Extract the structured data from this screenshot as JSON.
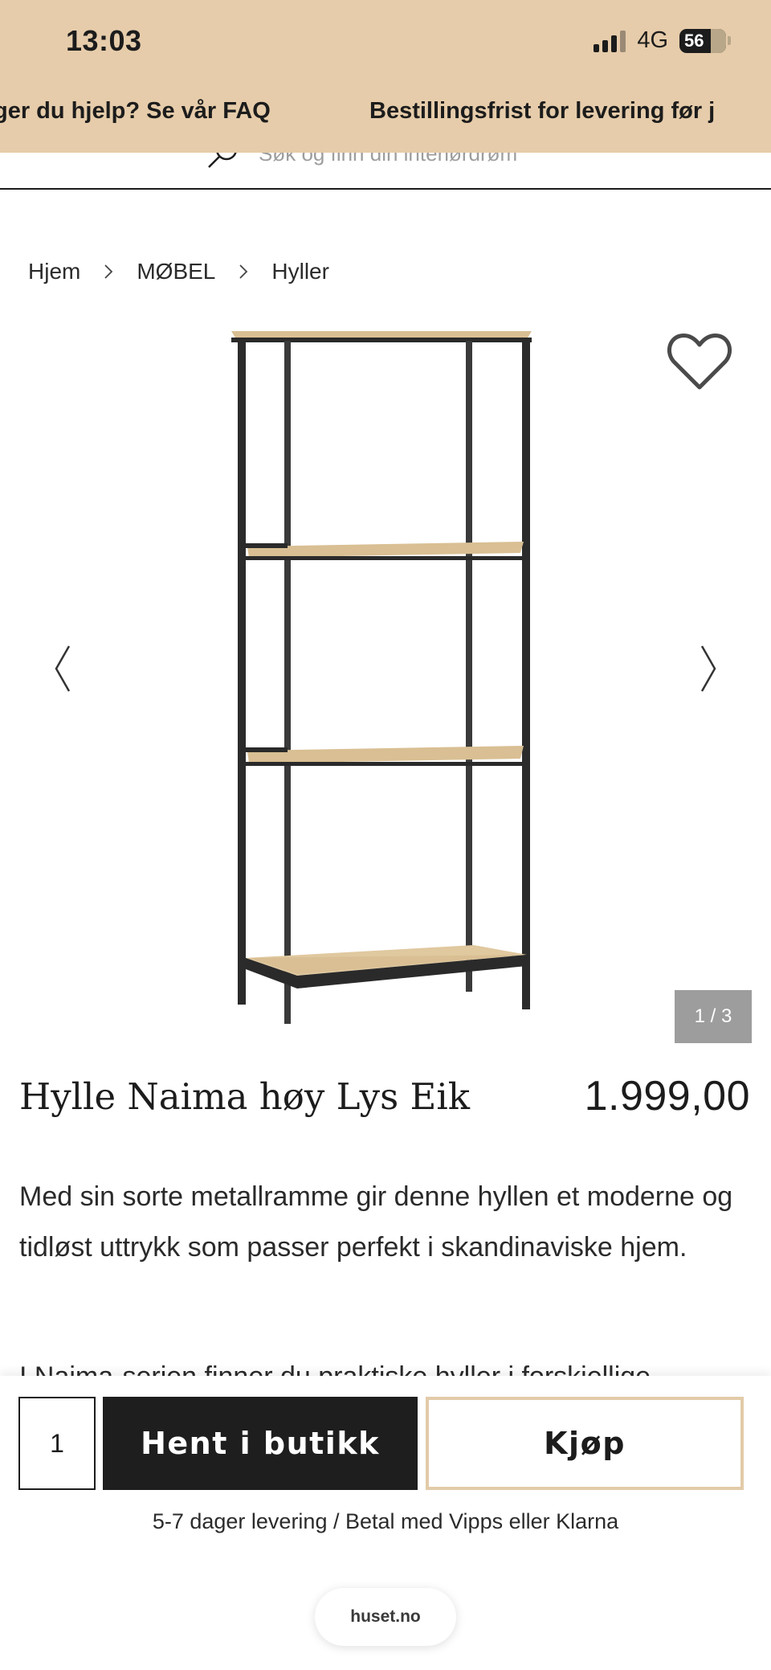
{
  "status_bar": {
    "time": "13:03",
    "network": "4G",
    "battery": "56"
  },
  "promo": {
    "left": "ger du hjelp? Se vår FAQ",
    "right": "Bestillingsfrist for levering før j"
  },
  "search": {
    "placeholder": "Søk og finn din interiørdrøm"
  },
  "breadcrumb": {
    "items": [
      "Hjem",
      "MØBEL",
      "Hyller"
    ]
  },
  "gallery": {
    "counter": "1 / 3"
  },
  "product": {
    "title": "Hylle Naima høy Lys Eik",
    "price": "1.999,00",
    "description": "Med sin sorte metallramme gir denne hyllen et moderne og tidløst uttrykk som passer perfekt i skandinaviske hjem.",
    "description_cut": "I Naima-serien finner du praktiske hyller i forskjellige"
  },
  "buy_bar": {
    "quantity": "1",
    "pickup_label": "Hent i butikk",
    "buy_label": "Kjøp",
    "delivery_note": "5-7 dager levering / Betal med Vipps eller Klarna"
  },
  "browser": {
    "url": "huset.no"
  },
  "colors": {
    "banner": "#e6ccaa",
    "buy_border": "#e2cba9",
    "dark_button": "#1e1e1e",
    "counter_bg": "#9d9d9d"
  }
}
